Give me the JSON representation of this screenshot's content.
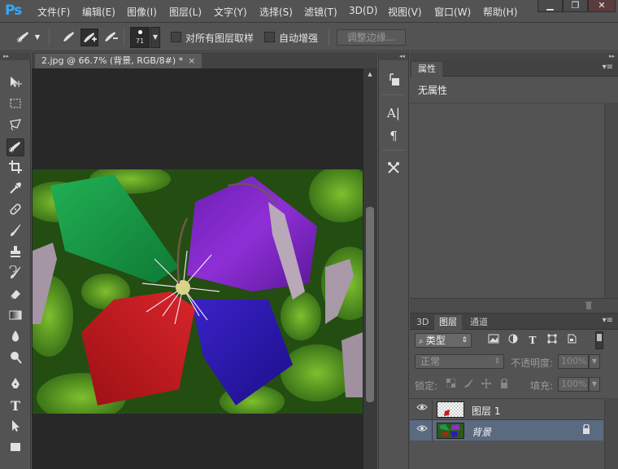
{
  "app": {
    "logo": "Ps"
  },
  "menubar": {
    "items": [
      "文件(F)",
      "编辑(E)",
      "图像(I)",
      "图层(L)",
      "文字(Y)",
      "选择(S)",
      "滤镜(T)",
      "3D(D)",
      "视图(V)",
      "窗口(W)",
      "帮助(H)"
    ],
    "window_buttons": [
      "▁",
      "❐",
      "✕"
    ]
  },
  "options": {
    "brush_size": "71",
    "sample_all_layers_label": "对所有图层取样",
    "sample_all_layers_checked": false,
    "auto_enhance_label": "自动增强",
    "auto_enhance_checked": false,
    "refine_edge_label": "调整边缘..."
  },
  "document": {
    "tab_title": "2.jpg @ 66.7% (背景, RGB/8#) *",
    "close_glyph": "×"
  },
  "properties": {
    "tab_label": "属性",
    "message": "无属性"
  },
  "layers_panel": {
    "tabs": [
      "3D",
      "图层",
      "通道"
    ],
    "active_tab": "图层",
    "kind_label": "类型",
    "blend_mode": "正常",
    "opacity_label": "不透明度:",
    "opacity_value": "100%",
    "lock_label": "锁定:",
    "fill_label": "填充:",
    "fill_value": "100%",
    "layers": [
      {
        "name": "图层 1",
        "visible": true,
        "selected": false
      },
      {
        "name": "背景",
        "visible": true,
        "selected": true,
        "locked": true
      }
    ]
  },
  "colors": {
    "panel_bg": "#535353",
    "canvas_bg": "#282828",
    "accent_logo": "#31a8ff",
    "selected_layer": "#5a6a80"
  }
}
